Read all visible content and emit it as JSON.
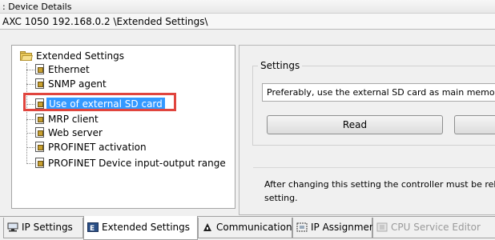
{
  "window": {
    "title": "Device Details"
  },
  "path": "AXC 1050 192.168.0.2 \\Extended Settings\\",
  "tree": {
    "root": "Extended Settings",
    "items": [
      {
        "label": "Ethernet"
      },
      {
        "label": "SNMP agent"
      },
      {
        "label": "Use of external SD card"
      },
      {
        "label": "MRP client"
      },
      {
        "label": "Web server"
      },
      {
        "label": "PROFINET activation"
      },
      {
        "label": "PROFINET Device input-output range"
      }
    ]
  },
  "settings": {
    "group_label": "Settings",
    "selected_option": "Preferably, use the external SD card as main memory",
    "read_label": "Read",
    "info_line1": "After changing this setting the controller must be rebooted to activate the",
    "info_line2": "setting."
  },
  "tabs": [
    {
      "label": "IP Settings",
      "icon": "network-icon"
    },
    {
      "label": "Extended Settings",
      "icon": "extended-settings-icon"
    },
    {
      "label": "Communication",
      "icon": "communication-icon"
    },
    {
      "label": "IP Assignment",
      "icon": "ip-assignment-icon"
    },
    {
      "label": "CPU Service Editor",
      "icon": "cpu-service-icon"
    }
  ],
  "colors": {
    "selection": "#3399ff",
    "highlight_box": "#e0453e"
  }
}
